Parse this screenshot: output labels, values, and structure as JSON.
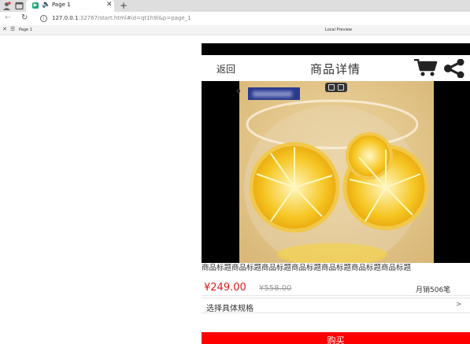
{
  "browser": {
    "tab": {
      "title": "Page 1",
      "favicon": "app-icon"
    },
    "url": {
      "host": "127.0.0.1",
      "rest": ":32767/start.html#id=qt1h9l&p=page_1"
    },
    "devbar": {
      "page_label": "Page 1",
      "center_label": "Local Preview"
    }
  },
  "app": {
    "header": {
      "back_label": "返回",
      "title": "商品详情",
      "cart_icon": "cart-icon",
      "share_icon": "share-icon"
    },
    "product": {
      "title": "商品标题商品标题商品标题商品标题商品标题商品标题商品标题",
      "price": "¥249.00",
      "original_price": "¥558.00",
      "sales": "月销506笔"
    },
    "spec": {
      "label": "选择具体规格",
      "arrow": ">"
    },
    "buy_button": {
      "label": "购买"
    }
  },
  "colors": {
    "accent": "#ff0000",
    "price": "#e21a1a",
    "badge": "#2b3a8f"
  }
}
